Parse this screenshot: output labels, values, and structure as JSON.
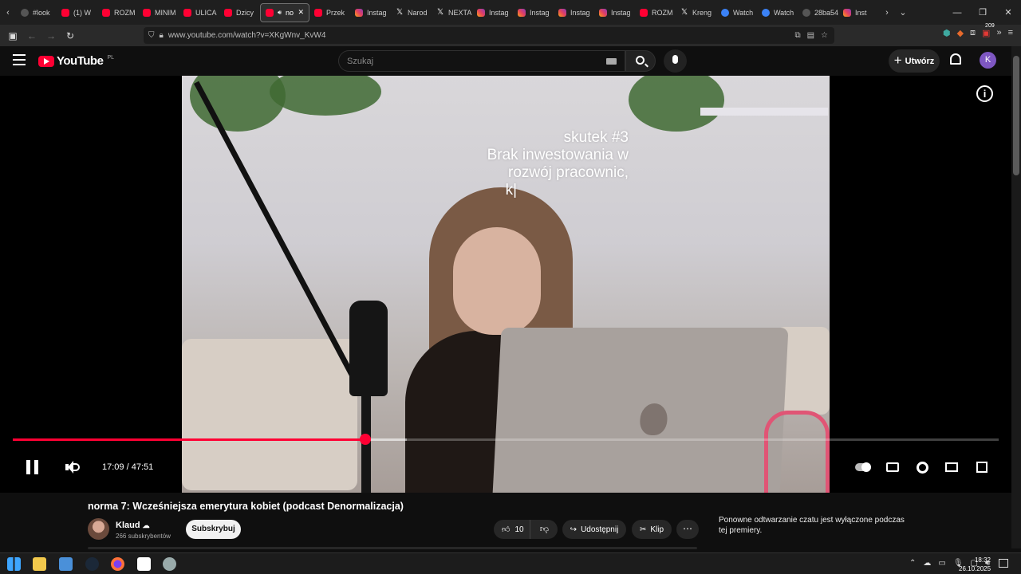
{
  "browser": {
    "tabs": [
      {
        "label": "#look",
        "icon": "generic-icon"
      },
      {
        "label": "(1) W",
        "icon": "youtube-icon"
      },
      {
        "label": "ROZM",
        "icon": "youtube-icon"
      },
      {
        "label": "MINIM",
        "icon": "youtube-icon"
      },
      {
        "label": "ULICA",
        "icon": "youtube-icon"
      },
      {
        "label": "Dzicy",
        "icon": "youtube-icon"
      },
      {
        "label": "no",
        "icon": "youtube-icon",
        "active": true
      },
      {
        "label": "Przek",
        "icon": "youtube-icon"
      },
      {
        "label": "Instag",
        "icon": "instagram-icon"
      },
      {
        "label": "Narod",
        "icon": "x-icon"
      },
      {
        "label": "NEXTA",
        "icon": "x-icon"
      },
      {
        "label": "Instag",
        "icon": "instagram-icon"
      },
      {
        "label": "Instag",
        "icon": "instagram-icon"
      },
      {
        "label": "Instag",
        "icon": "instagram-icon"
      },
      {
        "label": "Instag",
        "icon": "instagram-icon"
      },
      {
        "label": "ROZM",
        "icon": "youtube-icon"
      },
      {
        "label": "Kreng",
        "icon": "x-icon"
      },
      {
        "label": "Watch",
        "icon": "gc-icon"
      },
      {
        "label": "Watch",
        "icon": "gc-icon"
      },
      {
        "label": "28ba54a2",
        "icon": "generic-icon"
      },
      {
        "label": "Inst",
        "icon": "instagram-icon"
      }
    ],
    "url": "www.youtube.com/watch?v=XKgWnv_KvW4",
    "extension_badge": "209"
  },
  "youtube": {
    "logo_text": "YouTube",
    "logo_region": "PL",
    "search_placeholder": "Szukaj",
    "create_label": "Utwórz",
    "avatar_letter": "K"
  },
  "player": {
    "caption_lines": [
      "skutek #3",
      "Brak inwestowania w",
      "rozwój pracownic,",
      "k|"
    ],
    "current_time": "17:09",
    "duration": "47:51",
    "progress_fraction": 0.358,
    "buffered_fraction": 0.4
  },
  "video": {
    "title": "norma 7: Wcześniejsza emerytura kobiet (podcast Denormalizacja)",
    "channel": "Klaud",
    "subscribers": "266 subskrybentów",
    "subscribe_label": "Subskrybuj",
    "likes": "10",
    "share_label": "Udostępnij",
    "clip_label": "Klip",
    "chat_note": "Ponowne odtwarzanie czatu jest wyłączone podczas tej premiery."
  },
  "taskbar": {
    "time": "18:32",
    "date": "26.10.2025"
  },
  "colors": {
    "accent": "#ff0033",
    "background": "#0f0f0f",
    "chip": "#272727"
  }
}
